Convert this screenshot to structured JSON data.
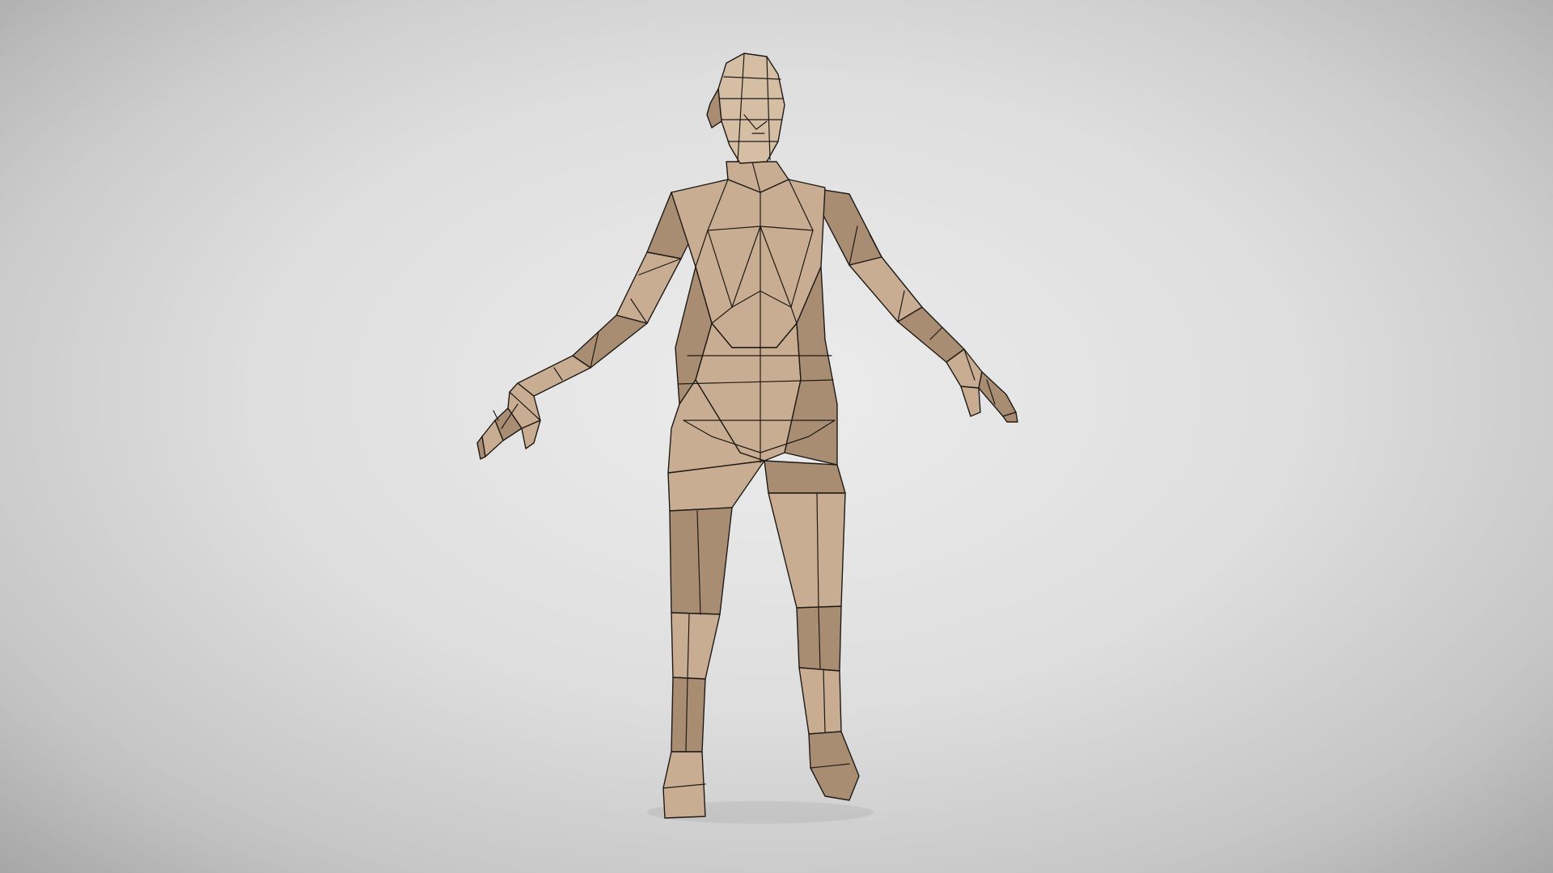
{
  "scene": {
    "subject": "low-poly-humanoid-mesh",
    "colors": {
      "background_center": "#ececec",
      "background_edge": "#a9a9a9",
      "skin_base": "#c8ad92",
      "skin_shadow": "#a98d72",
      "skin_highlight": "#d6bea4",
      "wireframe": "#1e1a17"
    }
  }
}
